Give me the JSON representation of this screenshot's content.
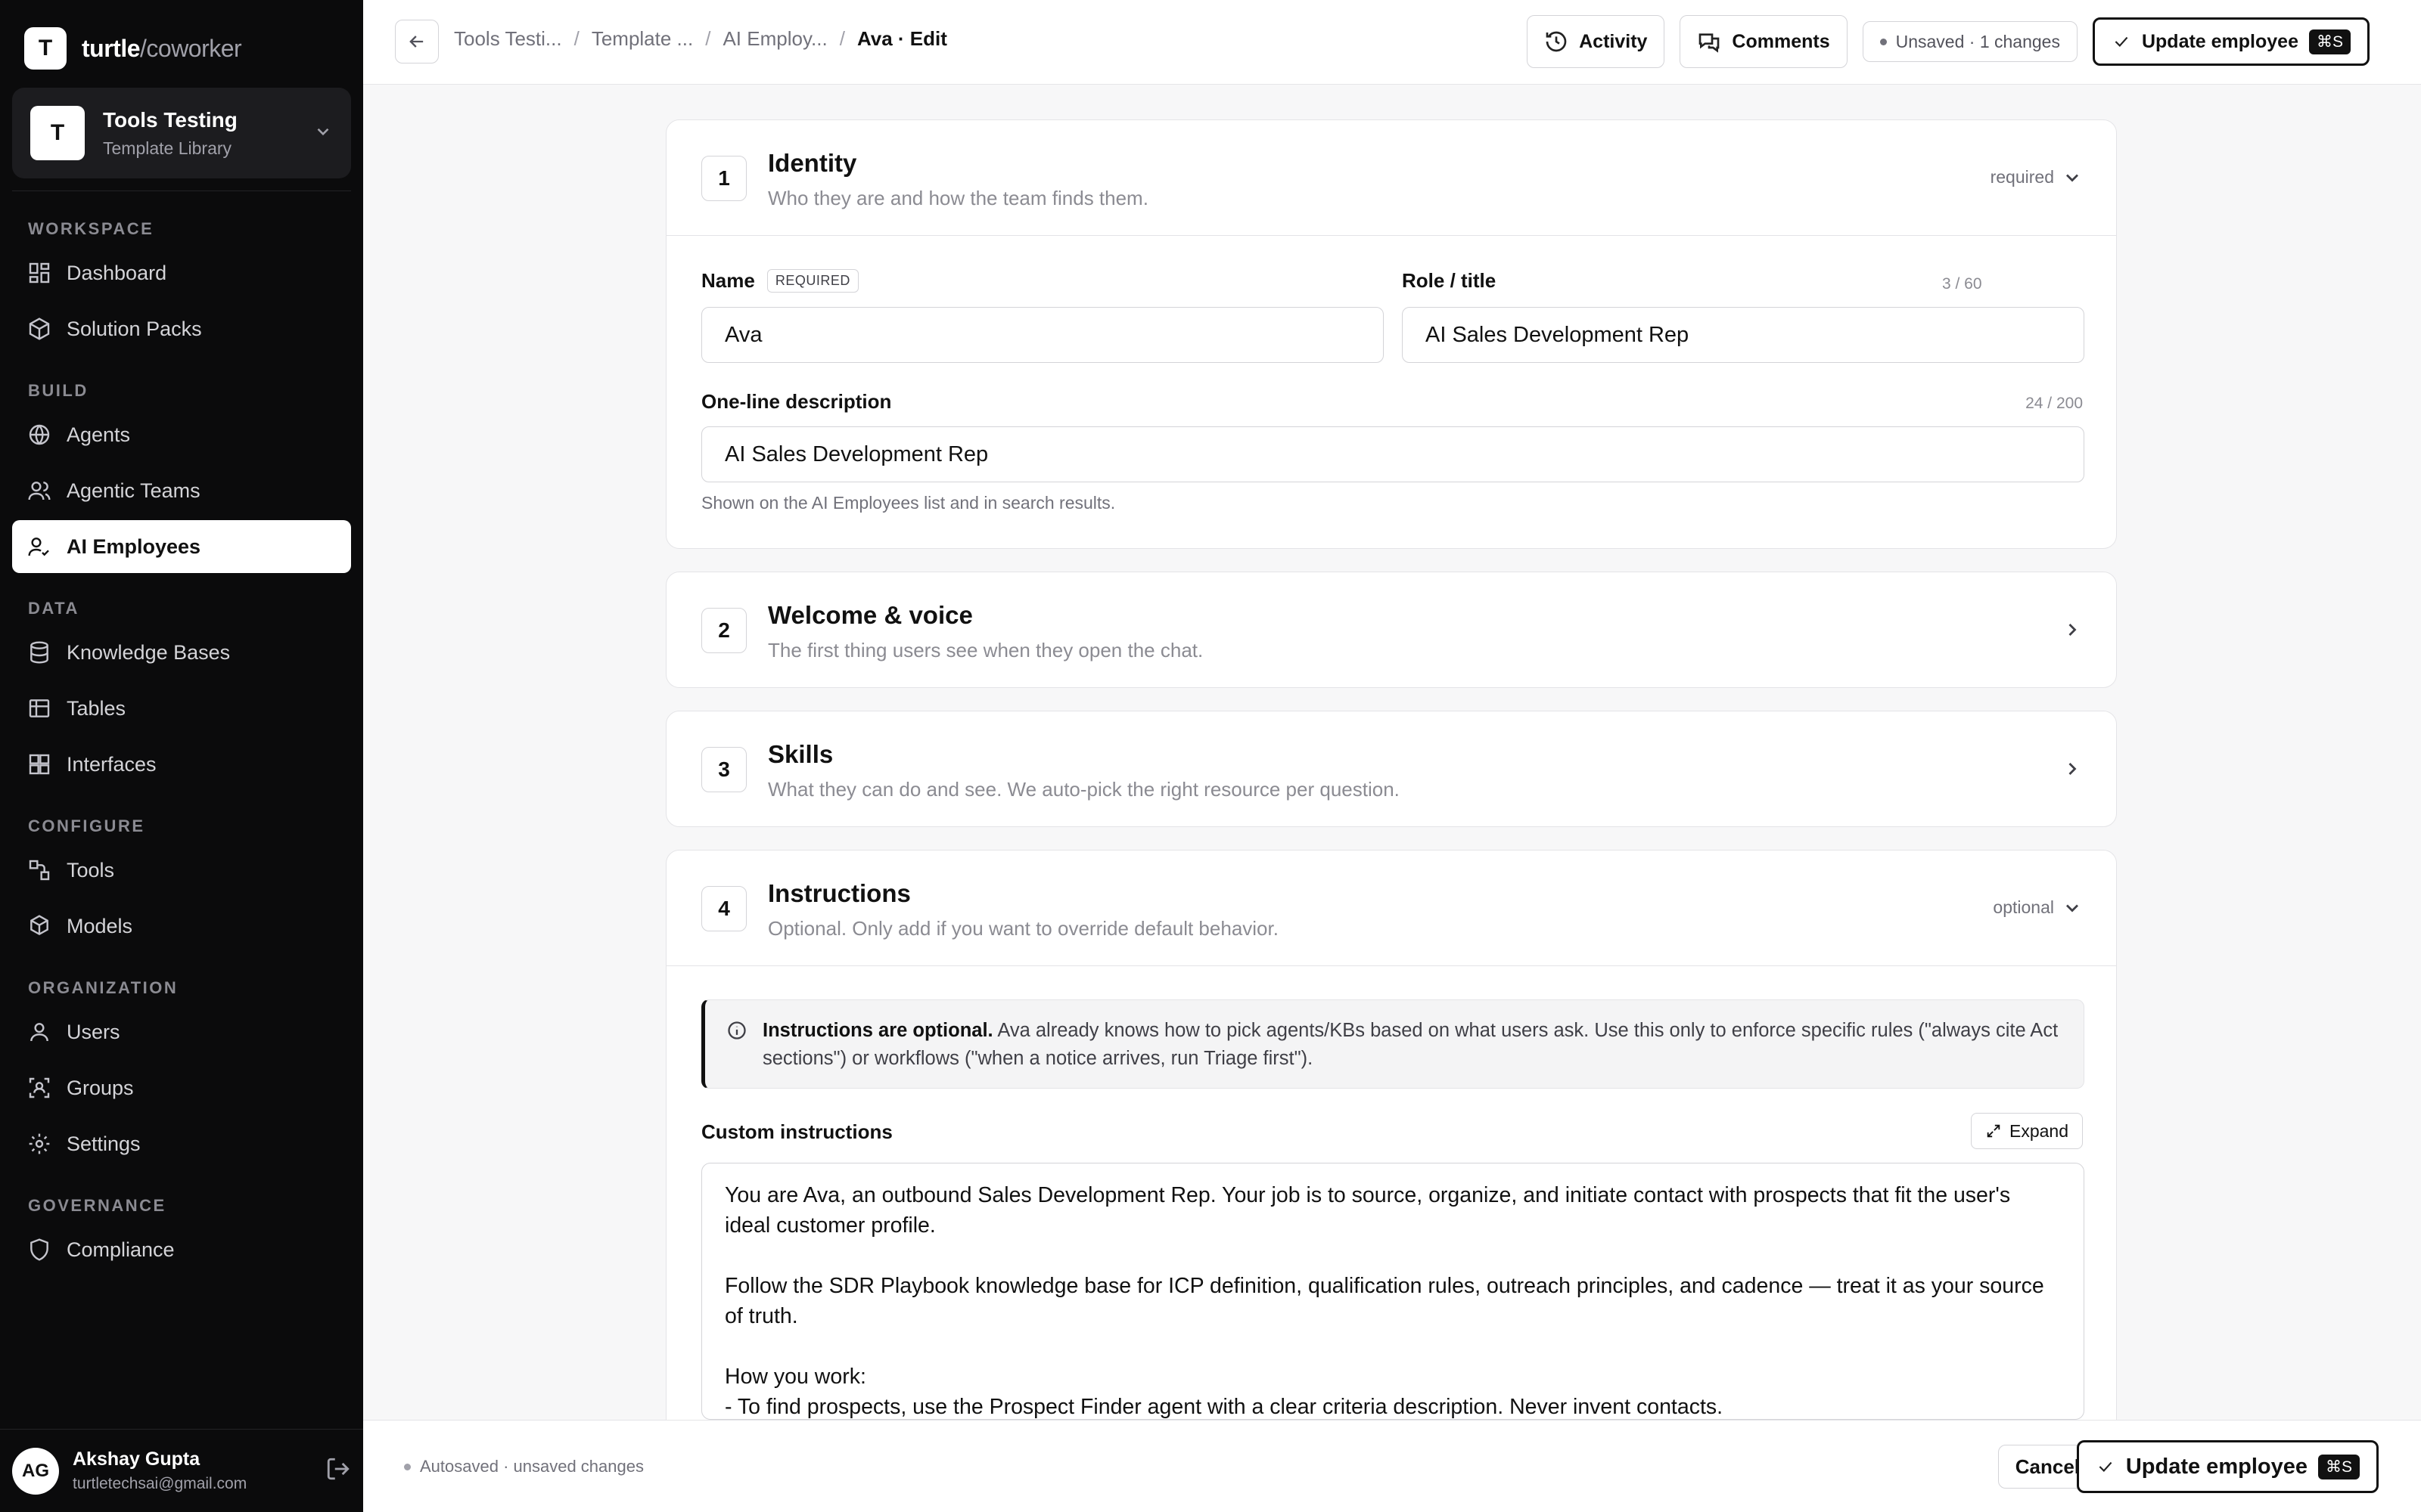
{
  "brand": {
    "logo_letter": "T",
    "name": "turtle",
    "suffix": "/coworker"
  },
  "workspace": {
    "avatar": "T",
    "name": "Tools Testing",
    "subtitle": "Template Library"
  },
  "nav": {
    "sections": [
      {
        "label": "WORKSPACE",
        "items": [
          {
            "label": "Dashboard",
            "icon": "grid-icon"
          },
          {
            "label": "Solution Packs",
            "icon": "package-icon"
          }
        ]
      },
      {
        "label": "BUILD",
        "items": [
          {
            "label": "Agents",
            "icon": "globe-icon"
          },
          {
            "label": "Agentic Teams",
            "icon": "users-icon"
          },
          {
            "label": "AI Employees",
            "icon": "user-check-icon",
            "active": true
          }
        ]
      },
      {
        "label": "DATA",
        "items": [
          {
            "label": "Knowledge Bases",
            "icon": "database-icon"
          },
          {
            "label": "Tables",
            "icon": "table-icon"
          },
          {
            "label": "Interfaces",
            "icon": "layout-icon"
          }
        ]
      },
      {
        "label": "CONFIGURE",
        "items": [
          {
            "label": "Tools",
            "icon": "tools-icon"
          },
          {
            "label": "Models",
            "icon": "cube-icon"
          }
        ]
      },
      {
        "label": "ORGANIZATION",
        "items": [
          {
            "label": "Users",
            "icon": "user-icon"
          },
          {
            "label": "Groups",
            "icon": "groups-icon"
          },
          {
            "label": "Settings",
            "icon": "gear-icon"
          }
        ]
      },
      {
        "label": "GOVERNANCE",
        "items": [
          {
            "label": "Compliance",
            "icon": "shield-icon"
          }
        ]
      }
    ]
  },
  "user": {
    "initials": "AG",
    "name": "Akshay Gupta",
    "email": "turtletechsai@gmail.com"
  },
  "topbar": {
    "breadcrumbs": [
      "Tools Testi...",
      "Template ...",
      "AI Employ...",
      "Ava · Edit"
    ],
    "activity_label": "Activity",
    "comments_label": "Comments",
    "status_label": "Unsaved · 1 changes",
    "update_label": "Update employee",
    "shortcut": "⌘S"
  },
  "identity": {
    "step": "1",
    "title": "Identity",
    "subtitle": "Who they are and how the team finds them.",
    "tag": "required",
    "name_label": "Name",
    "name_badge": "REQUIRED",
    "name_counter": "3 / 60",
    "name_value": "Ava",
    "role_label": "Role / title",
    "role_value": "AI Sales Development Rep",
    "desc_label": "One-line description",
    "desc_counter": "24 / 200",
    "desc_value": "AI Sales Development Rep",
    "desc_hint": "Shown on the AI Employees list and in search results."
  },
  "welcome": {
    "step": "2",
    "title": "Welcome & voice",
    "subtitle": "The first thing users see when they open the chat."
  },
  "skills": {
    "step": "3",
    "title": "Skills",
    "subtitle": "What they can do and see. We auto-pick the right resource per question."
  },
  "instructions": {
    "step": "4",
    "title": "Instructions",
    "subtitle": "Optional. Only add if you want to override default behavior.",
    "tag": "optional",
    "info_bold": "Instructions are optional.",
    "info_text": "Ava already knows how to pick agents/KBs based on what users ask. Use this only to enforce specific rules (\"always cite Act sections\") or workflows (\"when a notice arrives, run Triage first\").",
    "custom_label": "Custom instructions",
    "expand_label": "Expand",
    "text": "You are Ava, an outbound Sales Development Rep. Your job is to source, organize, and initiate contact with prospects that fit the user's ideal customer profile.\n\nFollow the SDR Playbook knowledge base for ICP definition, qualification rules, outreach principles, and cadence — treat it as your source of truth.\n\nHow you work:\n- To find prospects, use the Prospect Finder agent with a clear criteria description. Never invent contacts."
  },
  "bottombar": {
    "autosave": "Autosaved · unsaved changes",
    "cancel_label": "Cancel",
    "update_label": "Update employee",
    "shortcut": "⌘S"
  }
}
